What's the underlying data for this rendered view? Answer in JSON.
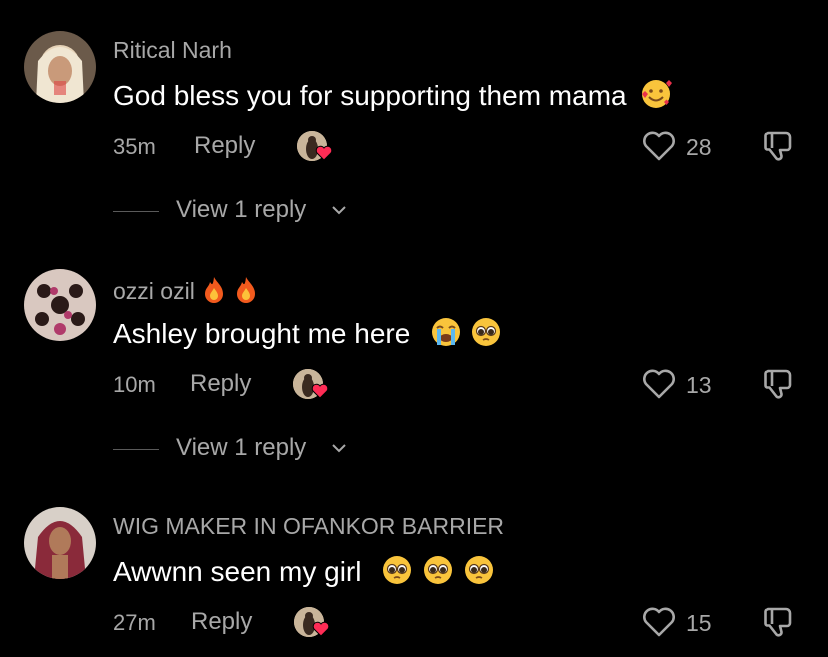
{
  "comments": [
    {
      "username": "Ritical Narh",
      "text": "God bless you for supporting them mama",
      "emojis": [
        "smiling-face-with-hearts"
      ],
      "time": "35m",
      "reply_label": "Reply",
      "likes": "28",
      "view_replies": "View 1 reply"
    },
    {
      "username": "ozzi ozil",
      "username_emojis": [
        "fire",
        "fire"
      ],
      "text": "Ashley brought me here",
      "emojis": [
        "loudly-crying-face",
        "pleading-face"
      ],
      "time": "10m",
      "reply_label": "Reply",
      "likes": "13",
      "view_replies": "View 1 reply"
    },
    {
      "username": "WIG MAKER IN  OFANKOR BARRIER",
      "text": "Awwnn seen my girl",
      "emojis": [
        "pleading-face",
        "pleading-face",
        "pleading-face"
      ],
      "time": "27m",
      "reply_label": "Reply",
      "likes": "15"
    }
  ],
  "colors": {
    "background": "#000000",
    "secondary_text": "#a8a8a8",
    "heart_badge": "#fe2c55"
  }
}
